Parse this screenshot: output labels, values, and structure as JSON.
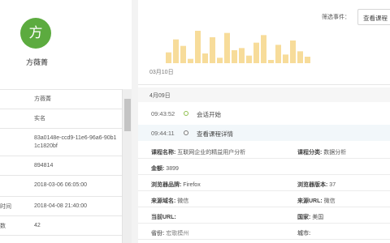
{
  "profile": {
    "avatar_char": "方",
    "name": "方薇菁",
    "rows": [
      {
        "label": "",
        "value": "方薇菁"
      },
      {
        "label": "",
        "value": "实名"
      },
      {
        "label": "",
        "value": "83a0148e-ccd9-11e6-96a6-90b11c1820bf"
      },
      {
        "label": "",
        "value": "894814"
      },
      {
        "label": "",
        "value": "2018-03-06 06:05:00"
      },
      {
        "label": "时间",
        "value": "2018-04-08 21:40:00"
      },
      {
        "label": "数",
        "value": "42"
      }
    ]
  },
  "filter": {
    "label": "筛选事件：",
    "button": "查看课程"
  },
  "chart_data": {
    "type": "bar",
    "xlabel": "03月10日",
    "values": [
      10,
      22,
      16,
      4,
      30,
      9,
      24,
      5,
      28,
      12,
      14,
      7,
      19,
      26,
      3,
      17,
      8,
      21,
      11,
      6
    ],
    "color": "#f7dc9a"
  },
  "timeline": {
    "date": "4月09日",
    "events": [
      {
        "time": "09:43:52",
        "name": "会话开始",
        "selected": false
      },
      {
        "time": "09:44:11",
        "name": "查看课程详情",
        "selected": true
      }
    ]
  },
  "details": {
    "rows": [
      {
        "l_label": "课程名称:",
        "l_value": "互联网企业的精益用户分析",
        "r_label": "课程分类:",
        "r_value": "数据分析"
      },
      {
        "l_label": "金额:",
        "l_value": "3899",
        "r_label": "",
        "r_value": ""
      },
      {
        "l_label": "浏览器品牌:",
        "l_value": "Firefox",
        "r_label": "浏览器版本:",
        "r_value": "37"
      },
      {
        "l_label": "来源域名:",
        "l_value": "微信",
        "r_label": "来源URL:",
        "r_value": "微信"
      },
      {
        "l_label": "当前URL:",
        "l_value": "",
        "r_label": "国家:",
        "r_value": "美国"
      },
      {
        "l_label": "省份:",
        "l_value": "宏歌模州",
        "r_label": "城市:",
        "r_value": ""
      }
    ]
  }
}
